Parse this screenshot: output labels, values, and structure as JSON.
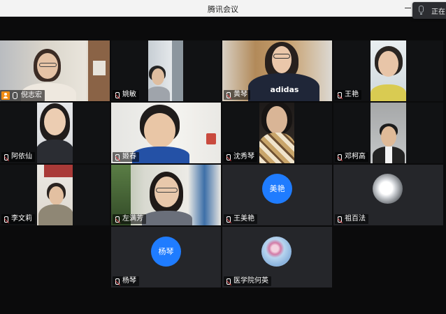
{
  "window": {
    "title": "腾讯会议"
  },
  "speaking_indicator": {
    "label": "正在"
  },
  "participants": [
    {
      "name": "倪志宏",
      "host": true
    },
    {
      "name": "姚敏"
    },
    {
      "name": "黄琴",
      "shirt_text": "adidas"
    },
    {
      "name": "王艳"
    },
    {
      "name": "阿依仙"
    },
    {
      "name": "姬春"
    },
    {
      "name": "沈秀琴"
    },
    {
      "name": "邓柯高"
    },
    {
      "name": "李文莉"
    },
    {
      "name": "左满芳"
    },
    {
      "name": "王美艳",
      "avatar_text": "美艳",
      "avatar_color": "#1f7cff"
    },
    {
      "name": "祖百法"
    },
    {
      "name": "杨琴",
      "avatar_text": "杨琴",
      "avatar_color": "#1f7cff"
    },
    {
      "name": "医学院何英"
    }
  ]
}
